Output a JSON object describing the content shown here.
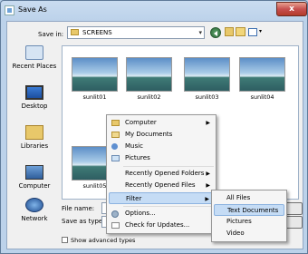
{
  "window": {
    "title": "Save As",
    "close_label": "x"
  },
  "toolbar": {
    "save_in_label": "Save in:",
    "save_in_value": "SCREENS"
  },
  "places": [
    {
      "label": "Recent Places",
      "icon": "recent-places-icon"
    },
    {
      "label": "Desktop",
      "icon": "desktop-icon"
    },
    {
      "label": "Libraries",
      "icon": "libraries-icon"
    },
    {
      "label": "Computer",
      "icon": "computer-icon"
    },
    {
      "label": "Network",
      "icon": "network-icon"
    }
  ],
  "files": [
    "sunlit01",
    "sunlit02",
    "sunlit03",
    "sunlit04",
    "sunlit05"
  ],
  "form": {
    "file_name_label": "File name:",
    "save_as_type_label": "Save as type:",
    "show_advanced_label": "Show advanced types"
  },
  "context_menu": {
    "items": [
      {
        "label": "Computer",
        "icon": "folder-icon",
        "submenu": true
      },
      {
        "label": "My Documents",
        "icon": "documents-icon",
        "submenu": false
      },
      {
        "label": "Music",
        "icon": "music-icon",
        "submenu": false
      },
      {
        "label": "Pictures",
        "icon": "pictures-icon",
        "submenu": false
      },
      {
        "label": "Recently Opened Folders",
        "icon": "",
        "submenu": true
      },
      {
        "label": "Recently Opened Files",
        "icon": "",
        "submenu": true
      },
      {
        "label": "Filter",
        "icon": "",
        "submenu": true,
        "highlighted": true
      },
      {
        "label": "Options...",
        "icon": "options-icon",
        "submenu": false
      },
      {
        "label": "Check for Updates...",
        "icon": "update-icon",
        "submenu": false
      }
    ]
  },
  "filter_submenu": {
    "items": [
      {
        "label": "All Files",
        "checked": false
      },
      {
        "label": "Text Documents",
        "highlighted": true
      },
      {
        "label": "Pictures"
      },
      {
        "label": "Video"
      }
    ]
  },
  "colors": {
    "highlight": "#c5dcf5",
    "window_frame": "#bcd2ea"
  }
}
